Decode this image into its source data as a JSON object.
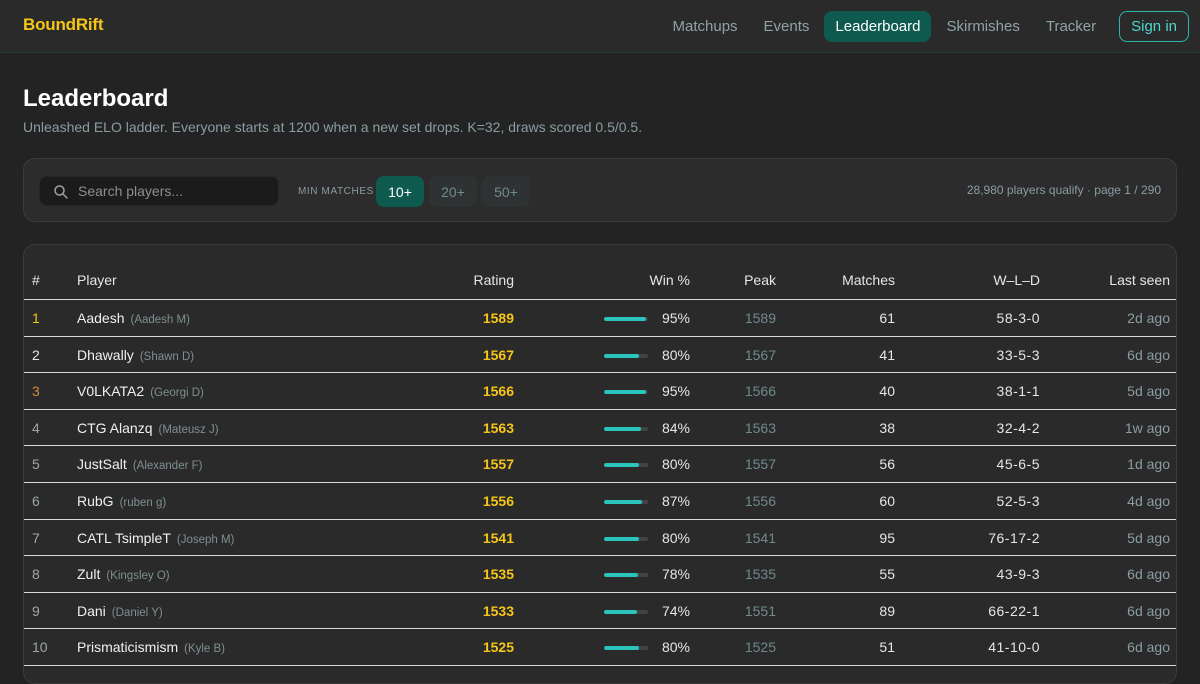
{
  "app": {
    "name": "BoundRift"
  },
  "nav": {
    "items": [
      {
        "label": "Matchups",
        "active": false
      },
      {
        "label": "Events",
        "active": false
      },
      {
        "label": "Leaderboard",
        "active": true
      },
      {
        "label": "Skirmishes",
        "active": false
      },
      {
        "label": "Tracker",
        "active": false
      }
    ],
    "sign_in": "Sign in"
  },
  "page": {
    "title": "Leaderboard",
    "subtitle": "Unleashed ELO ladder. Everyone starts at 1200 when a new set drops. K=32, draws scored 0.5/0.5."
  },
  "filters": {
    "search_placeholder": "Search players...",
    "search_value": "",
    "min_matches_label": "MIN MATCHES",
    "chips": [
      {
        "label": "10+",
        "active": true
      },
      {
        "label": "20+",
        "active": false
      },
      {
        "label": "50+",
        "active": false
      }
    ],
    "qualify_text": "28,980 players qualify · page 1 / 290"
  },
  "table": {
    "columns": {
      "rank": "#",
      "player": "Player",
      "rating": "Rating",
      "win": "Win %",
      "peak": "Peak",
      "matches": "Matches",
      "wld": "W–L–D",
      "seen": "Last seen"
    },
    "rows": [
      {
        "rank": "1",
        "name": "Aadesh",
        "real": "(Aadesh M)",
        "rating": "1589",
        "win": "95%",
        "win_value": 95,
        "peak": "1589",
        "matches": "61",
        "wld": "58-3-0",
        "seen": "2d ago"
      },
      {
        "rank": "2",
        "name": "Dhawally",
        "real": "(Shawn D)",
        "rating": "1567",
        "win": "80%",
        "win_value": 80,
        "peak": "1567",
        "matches": "41",
        "wld": "33-5-3",
        "seen": "6d ago"
      },
      {
        "rank": "3",
        "name": "V0LKATA2",
        "real": "(Georgi D)",
        "rating": "1566",
        "win": "95%",
        "win_value": 95,
        "peak": "1566",
        "matches": "40",
        "wld": "38-1-1",
        "seen": "5d ago"
      },
      {
        "rank": "4",
        "name": "CTG Alanzq",
        "real": "(Mateusz J)",
        "rating": "1563",
        "win": "84%",
        "win_value": 84,
        "peak": "1563",
        "matches": "38",
        "wld": "32-4-2",
        "seen": "1w ago"
      },
      {
        "rank": "5",
        "name": "JustSalt",
        "real": "(Alexander F)",
        "rating": "1557",
        "win": "80%",
        "win_value": 80,
        "peak": "1557",
        "matches": "56",
        "wld": "45-6-5",
        "seen": "1d ago"
      },
      {
        "rank": "6",
        "name": "RubG",
        "real": "(ruben g)",
        "rating": "1556",
        "win": "87%",
        "win_value": 87,
        "peak": "1556",
        "matches": "60",
        "wld": "52-5-3",
        "seen": "4d ago"
      },
      {
        "rank": "7",
        "name": "CATL TsimpleT",
        "real": "(Joseph M)",
        "rating": "1541",
        "win": "80%",
        "win_value": 80,
        "peak": "1541",
        "matches": "95",
        "wld": "76-17-2",
        "seen": "5d ago"
      },
      {
        "rank": "8",
        "name": "Zult",
        "real": "(Kingsley O)",
        "rating": "1535",
        "win": "78%",
        "win_value": 78,
        "peak": "1535",
        "matches": "55",
        "wld": "43-9-3",
        "seen": "6d ago"
      },
      {
        "rank": "9",
        "name": "Dani",
        "real": "(Daniel Y)",
        "rating": "1533",
        "win": "74%",
        "win_value": 74,
        "peak": "1551",
        "matches": "89",
        "wld": "66-22-1",
        "seen": "6d ago"
      },
      {
        "rank": "10",
        "name": "Prismaticismism",
        "real": "(Kyle B)",
        "rating": "1525",
        "win": "80%",
        "win_value": 80,
        "peak": "1525",
        "matches": "51",
        "wld": "41-10-0",
        "seen": "6d ago"
      }
    ]
  },
  "colors": {
    "accent": "#0e5a4f",
    "brand": "#f5c518",
    "bar": "#2bc4bd",
    "rank1": "#f5c518",
    "rank3": "#d08a3a"
  }
}
